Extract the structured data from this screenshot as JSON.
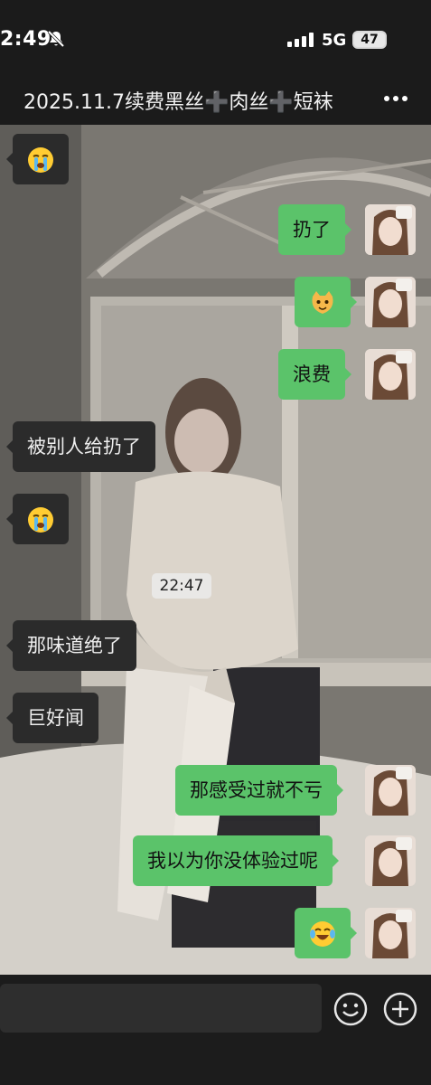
{
  "status_bar": {
    "time": "2:49",
    "network": "5G",
    "battery": "47"
  },
  "header": {
    "title": "2025.11.7续费黑丝➕肉丝➕短袜"
  },
  "messages": [
    {
      "side": "left",
      "text": "😭"
    },
    {
      "side": "right",
      "text": "扔了"
    },
    {
      "side": "right",
      "text": "🐱"
    },
    {
      "side": "right",
      "text": "浪费"
    },
    {
      "side": "left",
      "text": "被别人给扔了"
    },
    {
      "side": "left",
      "text": "😭"
    },
    {
      "side": "left",
      "text": "那味道绝了"
    },
    {
      "side": "left",
      "text": "巨好闻"
    },
    {
      "side": "right",
      "text": "那感受过就不亏"
    },
    {
      "side": "right",
      "text": "我以为你没体验过呢"
    },
    {
      "side": "right",
      "text": "😂"
    }
  ],
  "timestamp": "22:47",
  "icons": {
    "mute": "bell-slash-icon",
    "signal": "signal-bars-icon",
    "more": "more-dots-icon",
    "emoji": "smiley-face-icon",
    "plus": "plus-circle-icon"
  },
  "colors": {
    "bubble_right": "#5bc36a",
    "bubble_left": "#2b2b2b",
    "bar": "#1b1b1b"
  }
}
